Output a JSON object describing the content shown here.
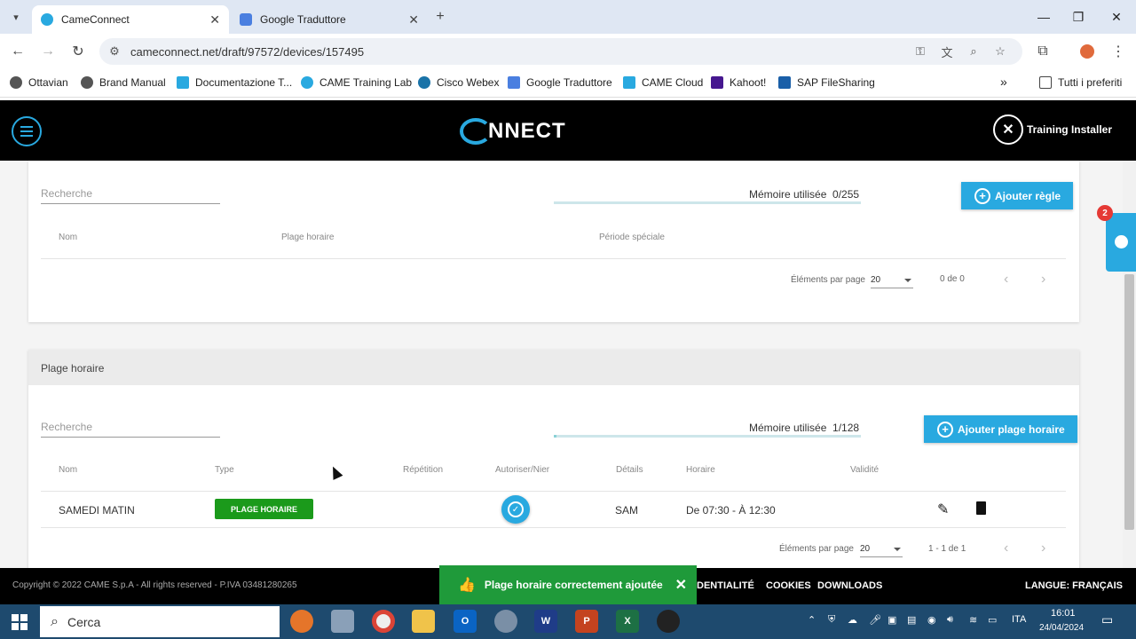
{
  "browser": {
    "tabs": [
      {
        "title": "CameConnect",
        "active": true
      },
      {
        "title": "Google Traduttore",
        "active": false
      }
    ],
    "url": "cameconnect.net/draft/97572/devices/157495",
    "bookmarks": [
      "Ottavian",
      "Brand Manual",
      "Documentazione T...",
      "CAME Training Lab",
      "Cisco Webex",
      "Google Traduttore",
      "CAME Cloud",
      "Kahoot!",
      "SAP FileSharing"
    ],
    "all_bookmarks": "Tutti i preferiti"
  },
  "header": {
    "logo": "NNECT",
    "user": "Training Installer"
  },
  "rules": {
    "search_placeholder": "Recherche",
    "memory_label": "Mémoire utilisée",
    "memory_value": "0/255",
    "memory_fraction": 0.0,
    "add_button": "Ajouter règle",
    "columns": [
      "Nom",
      "Plage horaire",
      "Période spéciale"
    ],
    "per_page_label": "Éléments par page",
    "per_page": "20",
    "count": "0 de 0"
  },
  "timeslots": {
    "section_title": "Plage horaire",
    "search_placeholder": "Recherche",
    "memory_label": "Mémoire utilisée",
    "memory_value": "1/128",
    "memory_fraction": 0.0078,
    "add_button": "Ajouter plage horaire",
    "columns": [
      "Nom",
      "Type",
      "Répétition",
      "Autoriser/Nier",
      "Détails",
      "Horaire",
      "Validité"
    ],
    "row": {
      "name": "SAMEDI MATIN",
      "type": "PLAGE HORAIRE",
      "details": "SAM",
      "schedule": "De 07:30 - À 12:30"
    },
    "per_page_label": "Éléments par page",
    "per_page": "20",
    "count": "1 - 1 de 1"
  },
  "side_badge": "2",
  "footer": {
    "copyright": "Copyright © 2022 CAME S.p.A - All rights reserved - P.IVA 03481280265",
    "confidentiality": "DENTIALITÉ",
    "cookies": "COOKIES",
    "downloads": "DOWNLOADS",
    "language": "LANGUE: FRANÇAIS"
  },
  "toast": {
    "message": "Plage horaire correctement ajoutée"
  },
  "taskbar": {
    "search_placeholder": "Cerca",
    "lang": "ITA",
    "time": "16:01",
    "date": "24/04/2024"
  },
  "colors": {
    "accent": "#29a9e0",
    "success": "#1f9a3a",
    "badge": "#e53935"
  }
}
